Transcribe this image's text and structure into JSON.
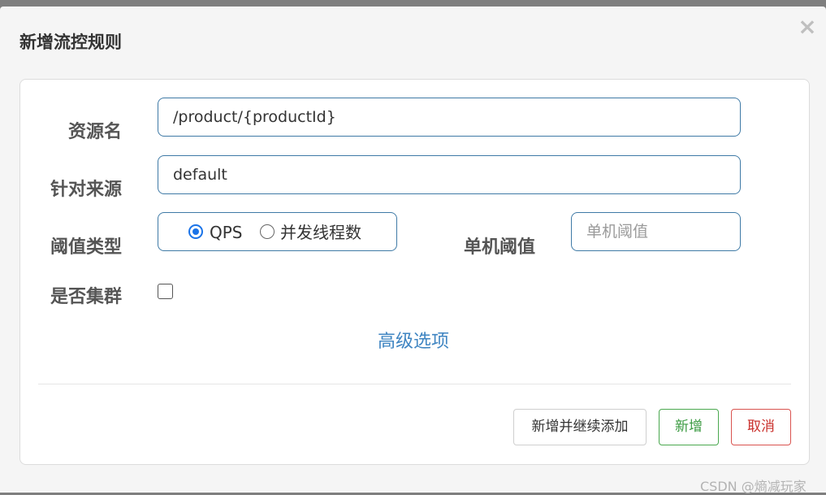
{
  "dialog": {
    "title": "新增流控规则",
    "close_label": "×"
  },
  "form": {
    "resource_name": {
      "label": "资源名",
      "value": "/product/{productId}"
    },
    "source": {
      "label": "针对来源",
      "value": "default"
    },
    "threshold_type": {
      "label": "阈值类型",
      "options": [
        {
          "label": "QPS",
          "selected": true
        },
        {
          "label": "并发线程数",
          "selected": false
        }
      ]
    },
    "single_threshold": {
      "label": "单机阈值",
      "placeholder": "单机阈值",
      "value": ""
    },
    "cluster": {
      "label": "是否集群",
      "checked": false
    },
    "advanced_link": "高级选项"
  },
  "actions": {
    "add_continue_label": "新增并继续添加",
    "add_label": "新增",
    "cancel_label": "取消"
  },
  "watermark": "CSDN @熵减玩家",
  "colors": {
    "input_border": "#3f7aa6",
    "radio_accent": "#1a73e8",
    "link": "#3f85c2",
    "add_green": "#4aa84f",
    "cancel_red": "#d9534f"
  }
}
